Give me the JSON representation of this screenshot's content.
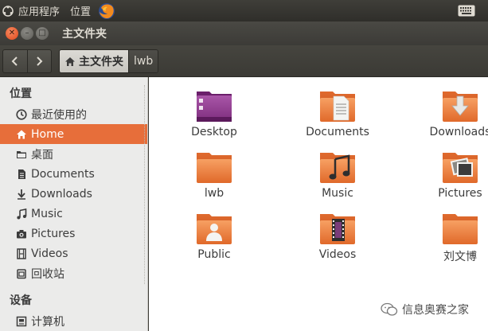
{
  "top_panel": {
    "menu_apps": "应用程序",
    "menu_places": "位置",
    "icons": [
      "ubuntu-logo-icon",
      "firefox-icon",
      "keyboard-icon"
    ]
  },
  "window": {
    "title": "主文件夹"
  },
  "breadcrumb": {
    "home": "主文件夹",
    "current": "lwb"
  },
  "sidebar": {
    "places_header": "位置",
    "devices_header": "设备",
    "items": [
      {
        "label": "最近使用的",
        "icon": "clock-icon"
      },
      {
        "label": "Home",
        "icon": "home-icon",
        "active": true
      },
      {
        "label": "桌面",
        "icon": "folder-icon"
      },
      {
        "label": "Documents",
        "icon": "document-icon"
      },
      {
        "label": "Downloads",
        "icon": "download-icon"
      },
      {
        "label": "Music",
        "icon": "music-icon"
      },
      {
        "label": "Pictures",
        "icon": "camera-icon"
      },
      {
        "label": "Videos",
        "icon": "film-icon"
      },
      {
        "label": "回收站",
        "icon": "trash-icon"
      }
    ],
    "devices": [
      {
        "label": "计算机",
        "icon": "computer-icon"
      }
    ]
  },
  "files": [
    {
      "label": "Desktop",
      "icon": "desktop-folder-icon"
    },
    {
      "label": "Documents",
      "icon": "documents-folder-icon"
    },
    {
      "label": "Downloads",
      "icon": "downloads-folder-icon"
    },
    {
      "label": "lwb",
      "icon": "folder-icon"
    },
    {
      "label": "Music",
      "icon": "music-folder-icon"
    },
    {
      "label": "Pictures",
      "icon": "pictures-folder-icon"
    },
    {
      "label": "Public",
      "icon": "public-folder-icon"
    },
    {
      "label": "Videos",
      "icon": "videos-folder-icon"
    },
    {
      "label": "刘文博",
      "icon": "folder-icon"
    }
  ],
  "watermark": {
    "text": "信息奥赛之家"
  },
  "colors": {
    "accent": "#e76e3a",
    "panel": "#3c3b37",
    "sidebar": "#ebebea",
    "folder": "#f08a4b",
    "desktop_folder": "#8e3b8e"
  }
}
